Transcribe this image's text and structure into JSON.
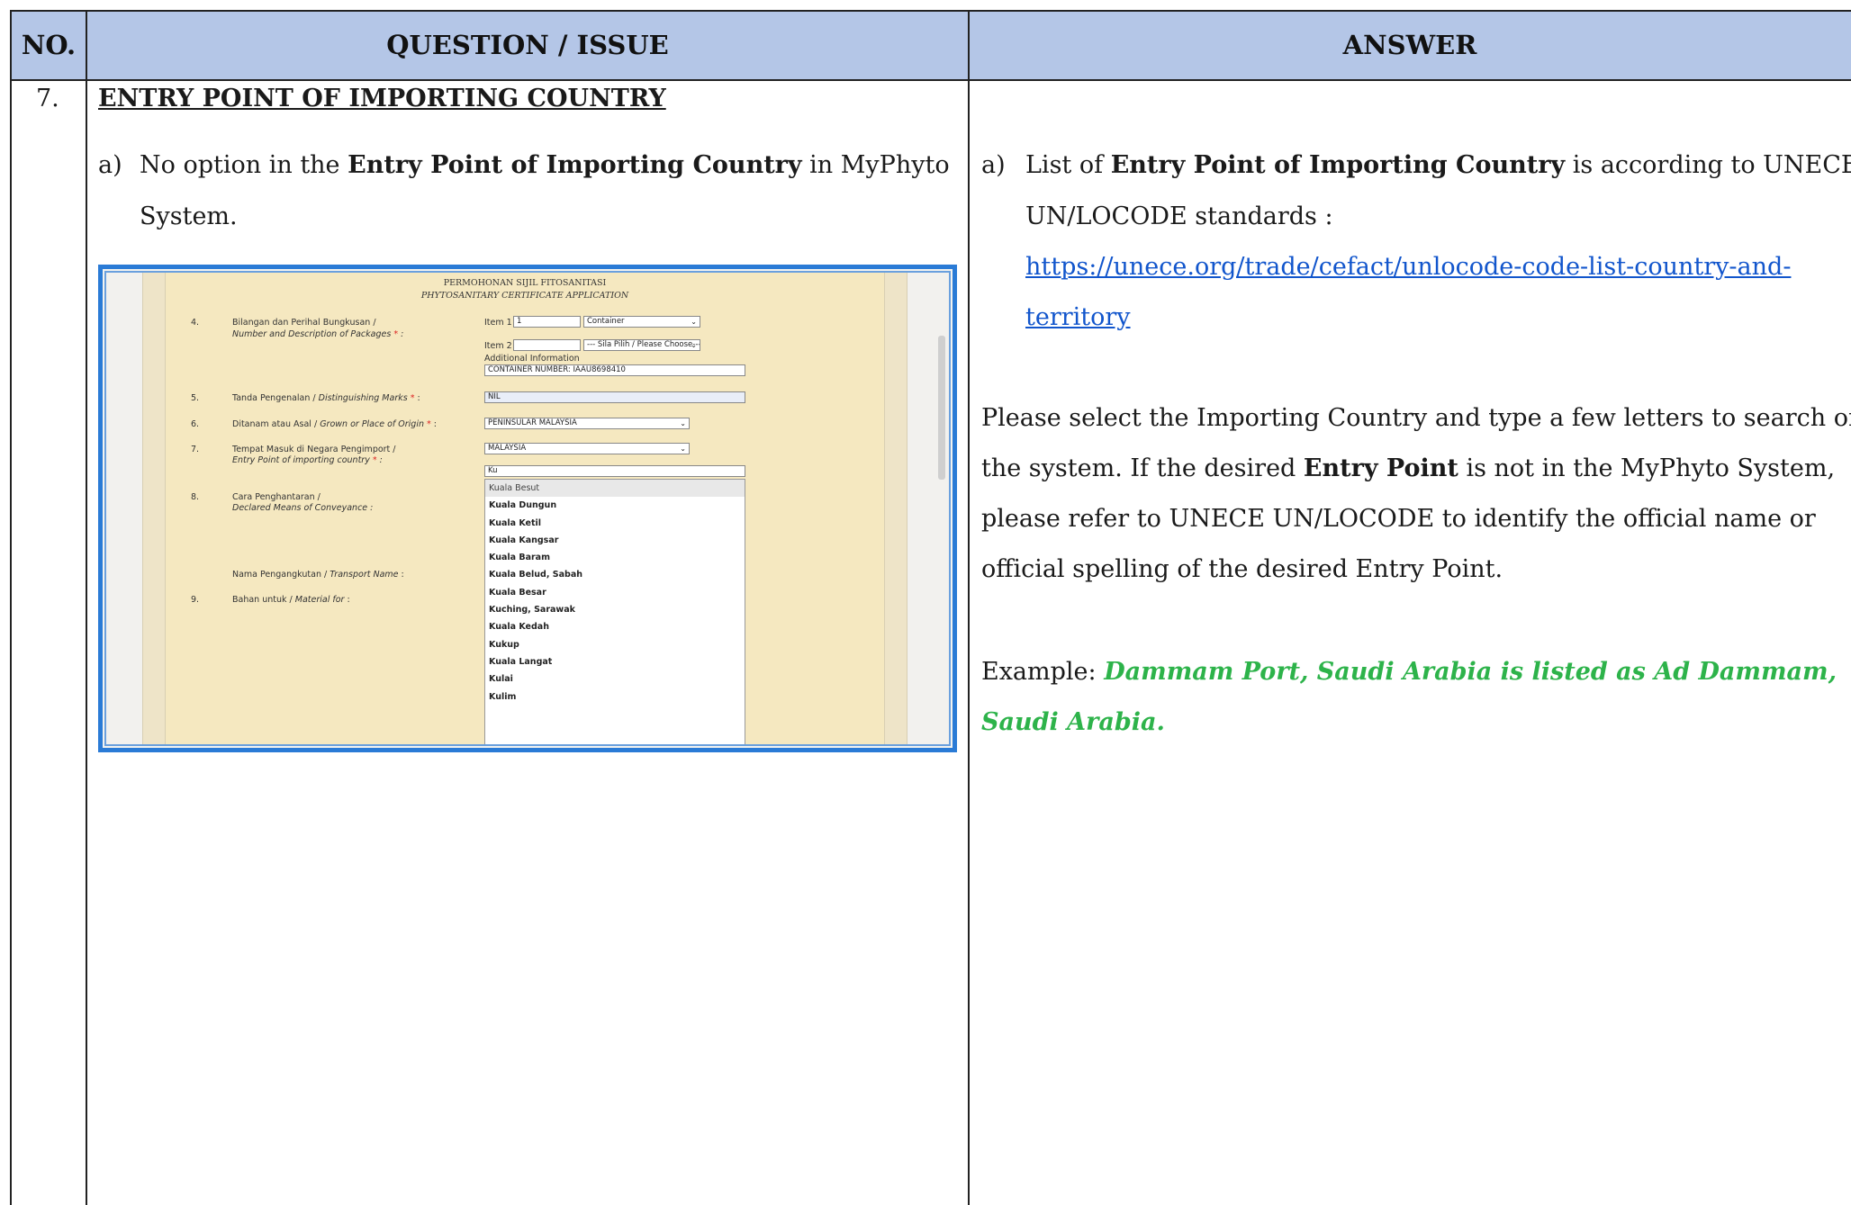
{
  "header": {
    "col_no": "NO.",
    "col_question": "QUESTION / ISSUE",
    "col_answer": "ANSWER"
  },
  "row": {
    "number": "7.",
    "section_title": "ENTRY POINT OF IMPORTING COUNTRY",
    "question": {
      "marker": "a)",
      "text_1": "No option in the ",
      "text_bold": "Entry Point of Importing Country",
      "text_2": " in MyPhyto",
      "text_line2": "System."
    },
    "answer": {
      "marker": "a)",
      "text_1": "List of ",
      "text_bold": "Entry Point of Importing Country",
      "text_2": " is according to UNECE",
      "text_line2": "UN/LOCODE standards :",
      "link_line1": "https://unece.org/trade/cefact/unlocode-code-list-country-and-",
      "link_line2": "territory",
      "para_line1": "Please select the Importing Country and type a few letters to search on",
      "para_line2a": "the system. If the desired ",
      "para_line2_bold": "Entry Point",
      "para_line2b": " is not in the MyPhyto System,",
      "para_line3": "please refer to UNECE UN/LOCODE to identify the official name or",
      "para_line4": "official spelling of the desired Entry Point.",
      "example_label": "Example: ",
      "example_line1": "Dammam Port, Saudi Arabia is listed as Ad Dammam,",
      "example_line2": "Saudi Arabia."
    }
  },
  "screenshot": {
    "title": "PERMOHONAN SIJIL FITOSANITASI",
    "subtitle": "PHYTOSANITARY CERTIFICATE APPLICATION",
    "fields": {
      "f4_no": "4.",
      "f4_label": "Bilangan dan Perihal Bungkusan /",
      "f4_label_en": "Number and Description of Packages",
      "item1_label": "Item 1",
      "item1_value": "1",
      "item1_select": "Container",
      "item2_label": "Item 2",
      "item2_select": "--- Sila Pilih / Please Choose---",
      "additional_label": "Additional Information",
      "additional_value": "CONTAINER NUMBER: IAAU8698410",
      "f5_no": "5.",
      "f5_label": "Tanda Pengenalan / ",
      "f5_label_en": "Distinguishing Marks",
      "f5_value": "NIL",
      "f6_no": "6.",
      "f6_label": "Ditanam atau Asal / ",
      "f6_label_en": "Grown or Place of Origin",
      "f6_value": "PENINSULAR MALAYSIA",
      "f7_no": "7.",
      "f7_label": "Tempat Masuk di Negara Pengimport /",
      "f7_label_en": "Entry Point of importing country",
      "f7_value": "MALAYSIA",
      "f7_search": "Ku",
      "f8_no": "8.",
      "f8_label": "Cara Penghantaran /",
      "f8_label_en": "Declared Means of Conveyance :",
      "transport_label": "Nama Pengangkutan / ",
      "transport_label_en": "Transport Name",
      "f9_no": "9.",
      "f9_label": "Bahan untuk / ",
      "f9_label_en": "Material for",
      "required_mark": "*",
      "colon": " :"
    },
    "dropdown_items": [
      "Kuala Besut",
      "Kuala Dungun",
      "Kuala Ketil",
      "Kuala Kangsar",
      "Kuala Baram",
      "Kuala Belud, Sabah",
      "Kuala Besar",
      "Kuching, Sarawak",
      "Kuala Kedah",
      "Kukup",
      "Kuala Langat",
      "Kulai",
      "Kulim"
    ]
  },
  "colors": {
    "header_bg": "#b4c6e7",
    "link": "#1155cc",
    "example_green": "#2db34a",
    "screenshot_border": "#2a7bd6",
    "form_bg": "#f5e8c0"
  }
}
